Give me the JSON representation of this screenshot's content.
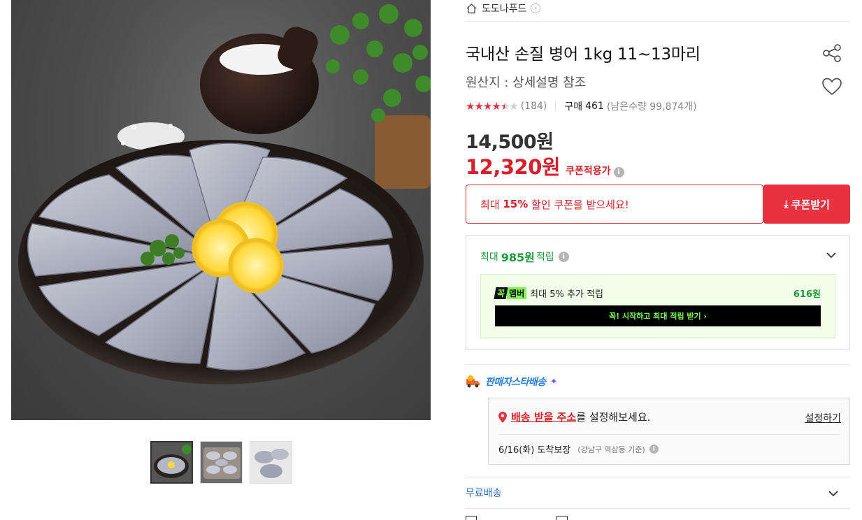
{
  "store": {
    "name": "도도나푸드",
    "chevron": "›"
  },
  "product": {
    "title": "국내산 손질 병어 1kg 11~13마리",
    "subtitle": "원산지 : 상세설명 참조",
    "rating_value": 4.5,
    "review_count": "(184)",
    "buy_label": "구매",
    "buy_count": "461",
    "remaining": "(남은수량 99,874개)"
  },
  "price": {
    "original": "14,500원",
    "sale": "12,320원",
    "coupon_label": "쿠폰적용가",
    "info_glyph": "i"
  },
  "coupon": {
    "text_prefix": "최대 ",
    "percent": "15%",
    "text_suffix": " 할인 쿠폰을 받으세요!",
    "button_label": "쿠폰받기",
    "button_glyph": "⤓"
  },
  "points": {
    "prefix": "최대",
    "amount": "985원",
    "suffix": "적립",
    "member_logo_a": "꼭",
    "member_logo_b": "멤버",
    "member_text": "최대 5% 추가 적립",
    "member_amount": "616원",
    "member_cta": "꼭! 시작하고 최대 적립 받기 ›"
  },
  "delivery": {
    "star_label": "판매자스타배송",
    "sparkle": "✦",
    "address_pin": "●",
    "address_link": "배송 받을 주소",
    "address_rest": "를 설정해보세요.",
    "address_set": "설정하기",
    "arrival": "6/16(화) 도착보장",
    "arrival_basis": "(강남구 역삼동 기준)",
    "free_shipping": "무료배송"
  },
  "icons": {
    "home": "home-icon",
    "share": "share-icon",
    "heart": "heart-icon",
    "chevron": "chevron-down-icon",
    "truck": "truck-icon"
  },
  "colors": {
    "accent_red": "#e8323f",
    "price_red": "#d91f2a",
    "points_green": "#1d9a3a",
    "member_green": "#7dfc54",
    "link_blue": "#2a6cc7"
  },
  "thumbnails": [
    "thumbnail-1",
    "thumbnail-2",
    "thumbnail-3"
  ]
}
